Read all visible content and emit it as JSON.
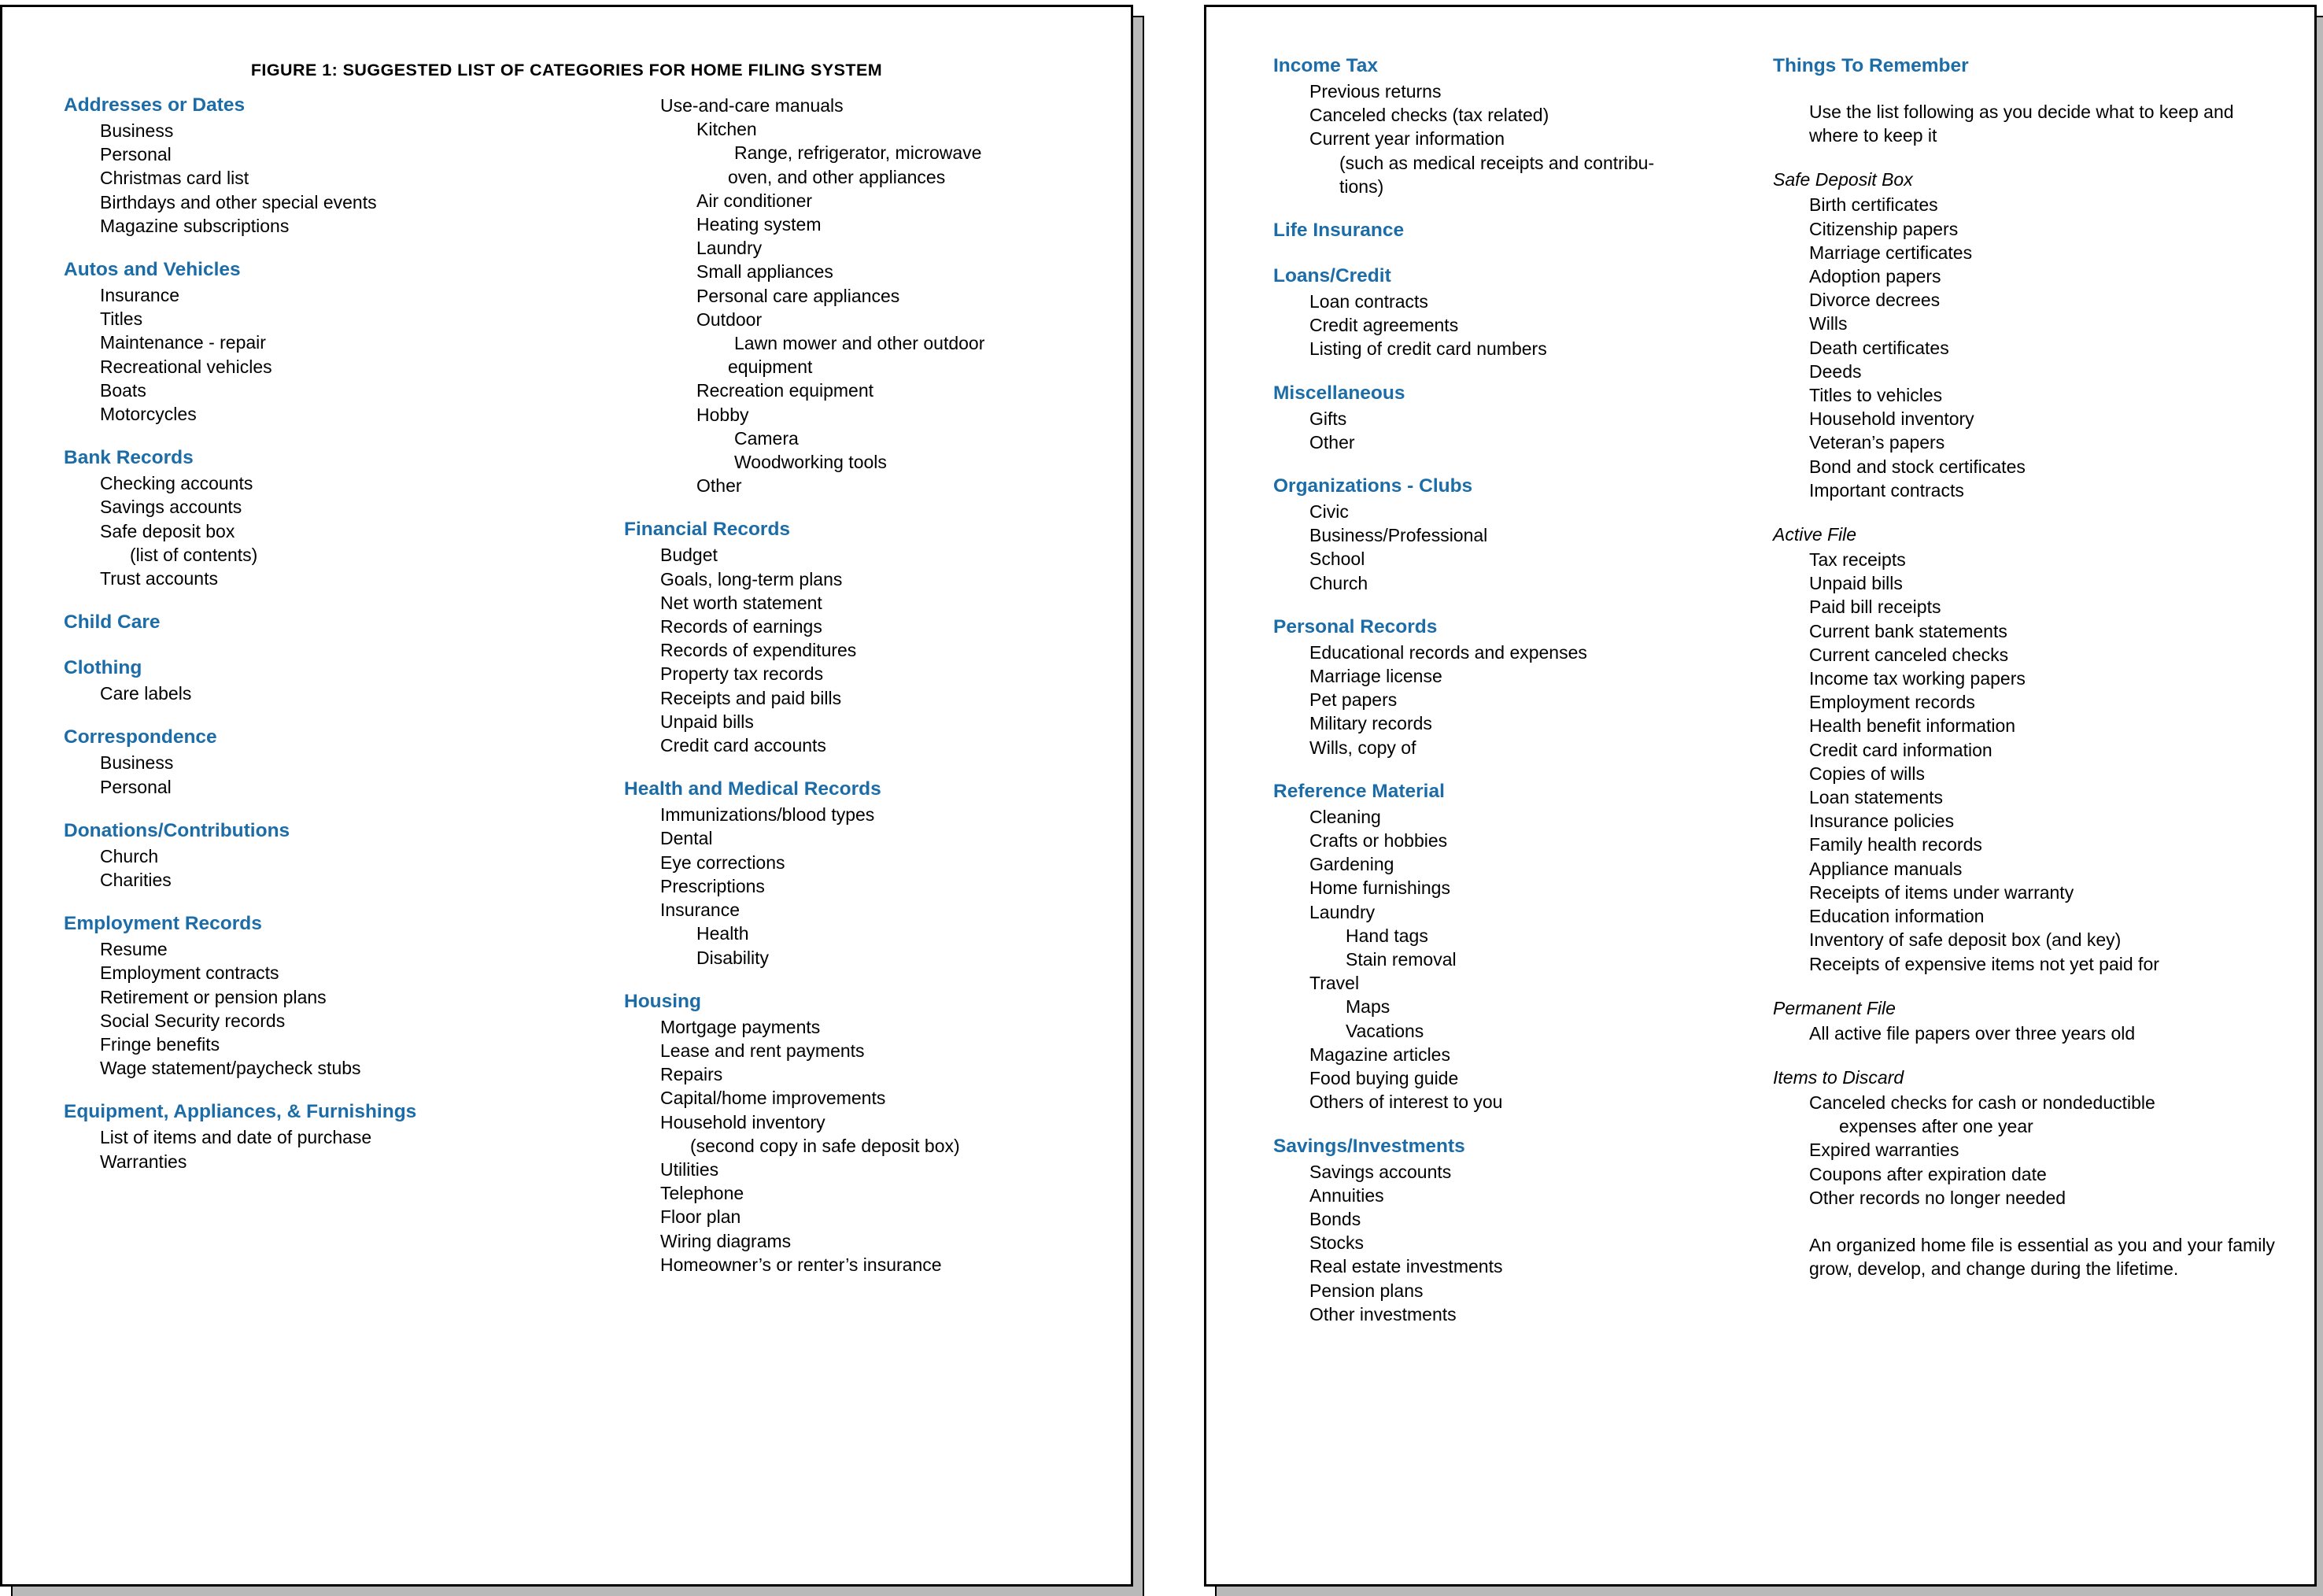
{
  "document": {
    "figure_title": "FIGURE 1:  SUGGESTED LIST OF CATEGORIES FOR HOME FILING SYSTEM",
    "accent_color": "#1c6ca8",
    "text_color": "#000000",
    "page_background": "#ffffff"
  },
  "page1": {
    "column1": [
      {
        "heading": "Addresses or Dates",
        "items": [
          {
            "text": "Business",
            "level": 1
          },
          {
            "text": "Personal",
            "level": 1
          },
          {
            "text": "Christmas card list",
            "level": 1
          },
          {
            "text": "Birthdays and other special events",
            "level": 1
          },
          {
            "text": "Magazine subscriptions",
            "level": 1
          }
        ]
      },
      {
        "heading": "Autos and Vehicles",
        "items": [
          {
            "text": "Insurance",
            "level": 1
          },
          {
            "text": "Titles",
            "level": 1
          },
          {
            "text": "Maintenance - repair",
            "level": 1
          },
          {
            "text": "Recreational vehicles",
            "level": 1
          },
          {
            "text": "Boats",
            "level": 1
          },
          {
            "text": "Motorcycles",
            "level": 1
          }
        ]
      },
      {
        "heading": "Bank Records",
        "items": [
          {
            "text": "Checking accounts",
            "level": 1
          },
          {
            "text": "Savings accounts",
            "level": 1
          },
          {
            "text": "Safe deposit box",
            "level": 1
          },
          {
            "text": "(list of contents)",
            "level": "cont"
          },
          {
            "text": "Trust accounts",
            "level": 1
          }
        ]
      },
      {
        "heading": "Child Care",
        "items": []
      },
      {
        "heading": "Clothing",
        "items": [
          {
            "text": "Care labels",
            "level": 1
          }
        ]
      },
      {
        "heading": "Correspondence",
        "items": [
          {
            "text": "Business",
            "level": 1
          },
          {
            "text": "Personal",
            "level": 1
          }
        ]
      },
      {
        "heading": "Donations/Contributions",
        "items": [
          {
            "text": "Church",
            "level": 1
          },
          {
            "text": "Charities",
            "level": 1
          }
        ]
      },
      {
        "heading": "Employment Records",
        "items": [
          {
            "text": "Resume",
            "level": 1
          },
          {
            "text": "Employment contracts",
            "level": 1
          },
          {
            "text": "Retirement or pension plans",
            "level": 1
          },
          {
            "text": "Social Security records",
            "level": 1
          },
          {
            "text": "Fringe benefits",
            "level": 1
          },
          {
            "text": "Wage statement/paycheck stubs",
            "level": 1
          }
        ]
      },
      {
        "heading": "Equipment, Appliances, & Furnishings",
        "items": [
          {
            "text": "List of items and date of purchase",
            "level": 1
          },
          {
            "text": "Warranties",
            "level": 1
          }
        ]
      }
    ],
    "column2": [
      {
        "heading": "",
        "items": [
          {
            "text": "Use-and-care manuals",
            "level": 1
          },
          {
            "text": "Kitchen",
            "level": 2
          },
          {
            "text": "Range, refrigerator, microwave",
            "level": 3
          },
          {
            "text": "oven, and other appliances",
            "level": "cont2"
          },
          {
            "text": "Air conditioner",
            "level": 2
          },
          {
            "text": "Heating system",
            "level": 2
          },
          {
            "text": "Laundry",
            "level": 2
          },
          {
            "text": "Small appliances",
            "level": 2
          },
          {
            "text": "Personal care appliances",
            "level": 2
          },
          {
            "text": "Outdoor",
            "level": 2
          },
          {
            "text": "Lawn mower and other outdoor",
            "level": 3
          },
          {
            "text": "equipment",
            "level": "cont2"
          },
          {
            "text": "Recreation equipment",
            "level": 2
          },
          {
            "text": "Hobby",
            "level": 2
          },
          {
            "text": "Camera",
            "level": 3
          },
          {
            "text": "Woodworking tools",
            "level": 3
          },
          {
            "text": "Other",
            "level": 2
          }
        ]
      },
      {
        "heading": "Financial Records",
        "items": [
          {
            "text": "Budget",
            "level": 1
          },
          {
            "text": "Goals, long-term plans",
            "level": 1
          },
          {
            "text": "Net worth statement",
            "level": 1
          },
          {
            "text": "Records of earnings",
            "level": 1
          },
          {
            "text": "Records of expenditures",
            "level": 1
          },
          {
            "text": "Property tax records",
            "level": 1
          },
          {
            "text": "Receipts and paid bills",
            "level": 1
          },
          {
            "text": "Unpaid bills",
            "level": 1
          },
          {
            "text": "Credit card accounts",
            "level": 1
          }
        ]
      },
      {
        "heading": "Health and Medical Records",
        "items": [
          {
            "text": "Immunizations/blood types",
            "level": 1
          },
          {
            "text": "Dental",
            "level": 1
          },
          {
            "text": "Eye corrections",
            "level": 1
          },
          {
            "text": "Prescriptions",
            "level": 1
          },
          {
            "text": "Insurance",
            "level": 1
          },
          {
            "text": "Health",
            "level": 2
          },
          {
            "text": "Disability",
            "level": 2
          }
        ]
      },
      {
        "heading": "Housing",
        "items": [
          {
            "text": "Mortgage payments",
            "level": 1
          },
          {
            "text": "Lease and rent payments",
            "level": 1
          },
          {
            "text": "Repairs",
            "level": 1
          },
          {
            "text": "Capital/home improvements",
            "level": 1
          },
          {
            "text": "Household inventory",
            "level": 1
          },
          {
            "text": "(second copy in safe deposit box)",
            "level": "cont"
          },
          {
            "text": "Utilities",
            "level": 1
          },
          {
            "text": "Telephone",
            "level": 1
          },
          {
            "text": "Floor plan",
            "level": 1
          },
          {
            "text": "Wiring diagrams",
            "level": 1
          },
          {
            "text": "Homeowner’s or renter’s insurance",
            "level": 1
          }
        ]
      }
    ]
  },
  "page2": {
    "column1": [
      {
        "heading": "Income Tax",
        "items": [
          {
            "text": "Previous returns",
            "level": 1
          },
          {
            "text": "Canceled checks (tax related)",
            "level": 1
          },
          {
            "text": "Current year information",
            "level": 1
          },
          {
            "text": "(such as medical receipts and contribu-",
            "level": "cont"
          },
          {
            "text": "tions)",
            "level": "cont"
          }
        ]
      },
      {
        "heading": "Life Insurance",
        "items": []
      },
      {
        "heading": "Loans/Credit",
        "items": [
          {
            "text": "Loan contracts",
            "level": 1
          },
          {
            "text": "Credit agreements",
            "level": 1
          },
          {
            "text": "Listing of credit card numbers",
            "level": 1
          }
        ]
      },
      {
        "heading": "Miscellaneous",
        "items": [
          {
            "text": "Gifts",
            "level": 1
          },
          {
            "text": "Other",
            "level": 1
          }
        ]
      },
      {
        "heading": "Organizations - Clubs",
        "items": [
          {
            "text": "Civic",
            "level": 1
          },
          {
            "text": "Business/Professional",
            "level": 1
          },
          {
            "text": "School",
            "level": 1
          },
          {
            "text": "Church",
            "level": 1
          }
        ]
      },
      {
        "heading": "Personal Records",
        "items": [
          {
            "text": "Educational records and expenses",
            "level": 1
          },
          {
            "text": "Marriage license",
            "level": 1
          },
          {
            "text": "Pet papers",
            "level": 1
          },
          {
            "text": "Military records",
            "level": 1
          },
          {
            "text": "Wills, copy of",
            "level": 1
          }
        ]
      },
      {
        "heading": "Reference Material",
        "items": [
          {
            "text": "Cleaning",
            "level": 1
          },
          {
            "text": "Crafts or hobbies",
            "level": 1
          },
          {
            "text": "Gardening",
            "level": 1
          },
          {
            "text": "Home furnishings",
            "level": 1
          },
          {
            "text": "Laundry",
            "level": 1
          },
          {
            "text": "Hand tags",
            "level": 2
          },
          {
            "text": "Stain removal",
            "level": 2
          },
          {
            "text": "Travel",
            "level": 1
          },
          {
            "text": "Maps",
            "level": 2
          },
          {
            "text": "Vacations",
            "level": 2
          },
          {
            "text": "Magazine articles",
            "level": 1
          },
          {
            "text": "Food buying guide",
            "level": 1
          },
          {
            "text": "Others of interest to you",
            "level": 1
          }
        ]
      },
      {
        "heading": "Savings/Investments",
        "items": [
          {
            "text": "Savings accounts",
            "level": 1
          },
          {
            "text": "Annuities",
            "level": 1
          },
          {
            "text": "Bonds",
            "level": 1
          },
          {
            "text": "Stocks",
            "level": 1
          },
          {
            "text": "Real estate investments",
            "level": 1
          },
          {
            "text": "Pension plans",
            "level": 1
          },
          {
            "text": "Other investments",
            "level": 1
          }
        ]
      }
    ],
    "column2": {
      "heading": "Things To Remember",
      "intro": "Use the list following as you decide what to keep and where to keep it",
      "groups": [
        {
          "subhead": "Safe Deposit Box",
          "items": [
            {
              "text": "Birth certificates",
              "level": 1
            },
            {
              "text": "Citizenship papers",
              "level": 1
            },
            {
              "text": "Marriage certificates",
              "level": 1
            },
            {
              "text": "Adoption papers",
              "level": 1
            },
            {
              "text": "Divorce decrees",
              "level": 1
            },
            {
              "text": "Wills",
              "level": 1
            },
            {
              "text": "Death certificates",
              "level": 1
            },
            {
              "text": "Deeds",
              "level": 1
            },
            {
              "text": "Titles to vehicles",
              "level": 1
            },
            {
              "text": "Household inventory",
              "level": 1
            },
            {
              "text": "Veteran’s papers",
              "level": 1
            },
            {
              "text": "Bond and stock certificates",
              "level": 1
            },
            {
              "text": "Important contracts",
              "level": 1
            }
          ]
        },
        {
          "subhead": "Active File",
          "items": [
            {
              "text": "Tax receipts",
              "level": 1
            },
            {
              "text": "Unpaid bills",
              "level": 1
            },
            {
              "text": "Paid bill receipts",
              "level": 1
            },
            {
              "text": "Current bank statements",
              "level": 1
            },
            {
              "text": "Current canceled checks",
              "level": 1
            },
            {
              "text": "Income tax working papers",
              "level": 1
            },
            {
              "text": "Employment records",
              "level": 1
            },
            {
              "text": "Health benefit information",
              "level": 1
            },
            {
              "text": "Credit card information",
              "level": 1
            },
            {
              "text": "Copies of wills",
              "level": 1
            },
            {
              "text": "Loan statements",
              "level": 1
            },
            {
              "text": "Insurance policies",
              "level": 1
            },
            {
              "text": "Family health records",
              "level": 1
            },
            {
              "text": "Appliance manuals",
              "level": 1
            },
            {
              "text": "Receipts of items under warranty",
              "level": 1
            },
            {
              "text": "Education information",
              "level": 1
            },
            {
              "text": "Inventory of safe deposit box (and key)",
              "level": 1
            },
            {
              "text": "Receipts of expensive items not yet paid for",
              "level": 1
            }
          ]
        },
        {
          "subhead": "Permanent File",
          "items": [
            {
              "text": "All active file papers over three years old",
              "level": 1
            }
          ]
        },
        {
          "subhead": "Items to Discard",
          "items": [
            {
              "text": "Canceled checks for cash or nondeductible",
              "level": 1
            },
            {
              "text": "expenses after one year",
              "level": "cont"
            },
            {
              "text": "Expired warranties",
              "level": 1
            },
            {
              "text": "Coupons after expiration date",
              "level": 1
            },
            {
              "text": "Other records no longer needed",
              "level": 1
            }
          ]
        }
      ],
      "closing": "An organized home file is essential as you and your family grow, develop, and change during the lifetime."
    }
  }
}
